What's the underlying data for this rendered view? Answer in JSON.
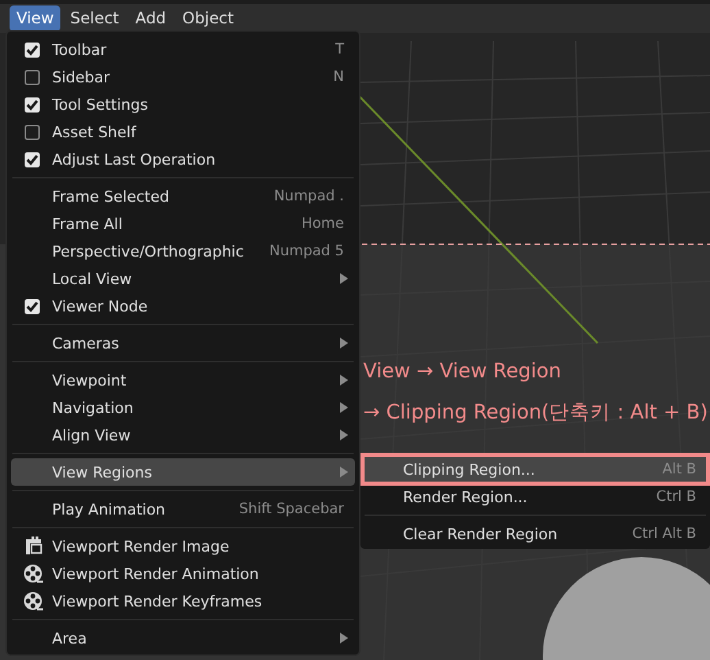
{
  "menubar": [
    {
      "label": "View",
      "selected": true
    },
    {
      "label": "Select",
      "selected": false
    },
    {
      "label": "Add",
      "selected": false
    },
    {
      "label": "Object",
      "selected": false
    }
  ],
  "menu": {
    "items": [
      {
        "kind": "check",
        "label": "Toolbar",
        "shortcut": "T",
        "checked": true,
        "has_submenu": false,
        "selected": false
      },
      {
        "kind": "check",
        "label": "Sidebar",
        "shortcut": "N",
        "checked": false,
        "has_submenu": false,
        "selected": false
      },
      {
        "kind": "check",
        "label": "Tool Settings",
        "checked": true,
        "has_submenu": false,
        "selected": false
      },
      {
        "kind": "check",
        "label": "Asset Shelf",
        "checked": false,
        "has_submenu": false,
        "selected": false
      },
      {
        "kind": "check",
        "label": "Adjust Last Operation",
        "checked": true,
        "has_submenu": false,
        "selected": false
      },
      {
        "kind": "separator"
      },
      {
        "kind": "item",
        "label": "Frame Selected",
        "shortcut": "Numpad .",
        "has_submenu": false,
        "selected": false
      },
      {
        "kind": "item",
        "label": "Frame All",
        "shortcut": "Home",
        "has_submenu": false,
        "selected": false
      },
      {
        "kind": "item",
        "label": "Perspective/Orthographic",
        "shortcut": "Numpad 5",
        "has_submenu": false,
        "selected": false
      },
      {
        "kind": "item",
        "label": "Local View",
        "has_submenu": true,
        "selected": false
      },
      {
        "kind": "check",
        "label": "Viewer Node",
        "checked": true,
        "has_submenu": false,
        "selected": false
      },
      {
        "kind": "separator"
      },
      {
        "kind": "item",
        "label": "Cameras",
        "has_submenu": true,
        "selected": false
      },
      {
        "kind": "separator"
      },
      {
        "kind": "item",
        "label": "Viewpoint",
        "has_submenu": true,
        "selected": false
      },
      {
        "kind": "item",
        "label": "Navigation",
        "has_submenu": true,
        "selected": false
      },
      {
        "kind": "item",
        "label": "Align View",
        "has_submenu": true,
        "selected": false
      },
      {
        "kind": "separator"
      },
      {
        "kind": "item",
        "label": "View Regions",
        "has_submenu": true,
        "selected": true
      },
      {
        "kind": "separator"
      },
      {
        "kind": "item",
        "label": "Play Animation",
        "shortcut": "Shift Spacebar",
        "has_submenu": false,
        "selected": false
      },
      {
        "kind": "separator"
      },
      {
        "kind": "image",
        "label": "Viewport Render Image",
        "has_submenu": false,
        "selected": false
      },
      {
        "kind": "reel",
        "label": "Viewport Render Animation",
        "has_submenu": false,
        "selected": false
      },
      {
        "kind": "reel",
        "label": "Viewport Render Keyframes",
        "has_submenu": false,
        "selected": false
      },
      {
        "kind": "separator"
      },
      {
        "kind": "item",
        "label": "Area",
        "has_submenu": true,
        "selected": false
      }
    ]
  },
  "submenu": {
    "items": [
      {
        "kind": "item",
        "label": "Clipping Region...",
        "shortcut": "Alt B",
        "selected": true,
        "annotated": true
      },
      {
        "kind": "item",
        "label": "Render Region...",
        "shortcut": "Ctrl B",
        "selected": false,
        "annotated": false
      },
      {
        "kind": "separator"
      },
      {
        "kind": "item",
        "label": "Clear Render Region",
        "shortcut": "Ctrl Alt B",
        "selected": false,
        "annotated": false
      }
    ]
  },
  "annotation": {
    "lines": [
      "View → View Region",
      "→ Clipping Region(단축키 : Alt + B)"
    ]
  }
}
